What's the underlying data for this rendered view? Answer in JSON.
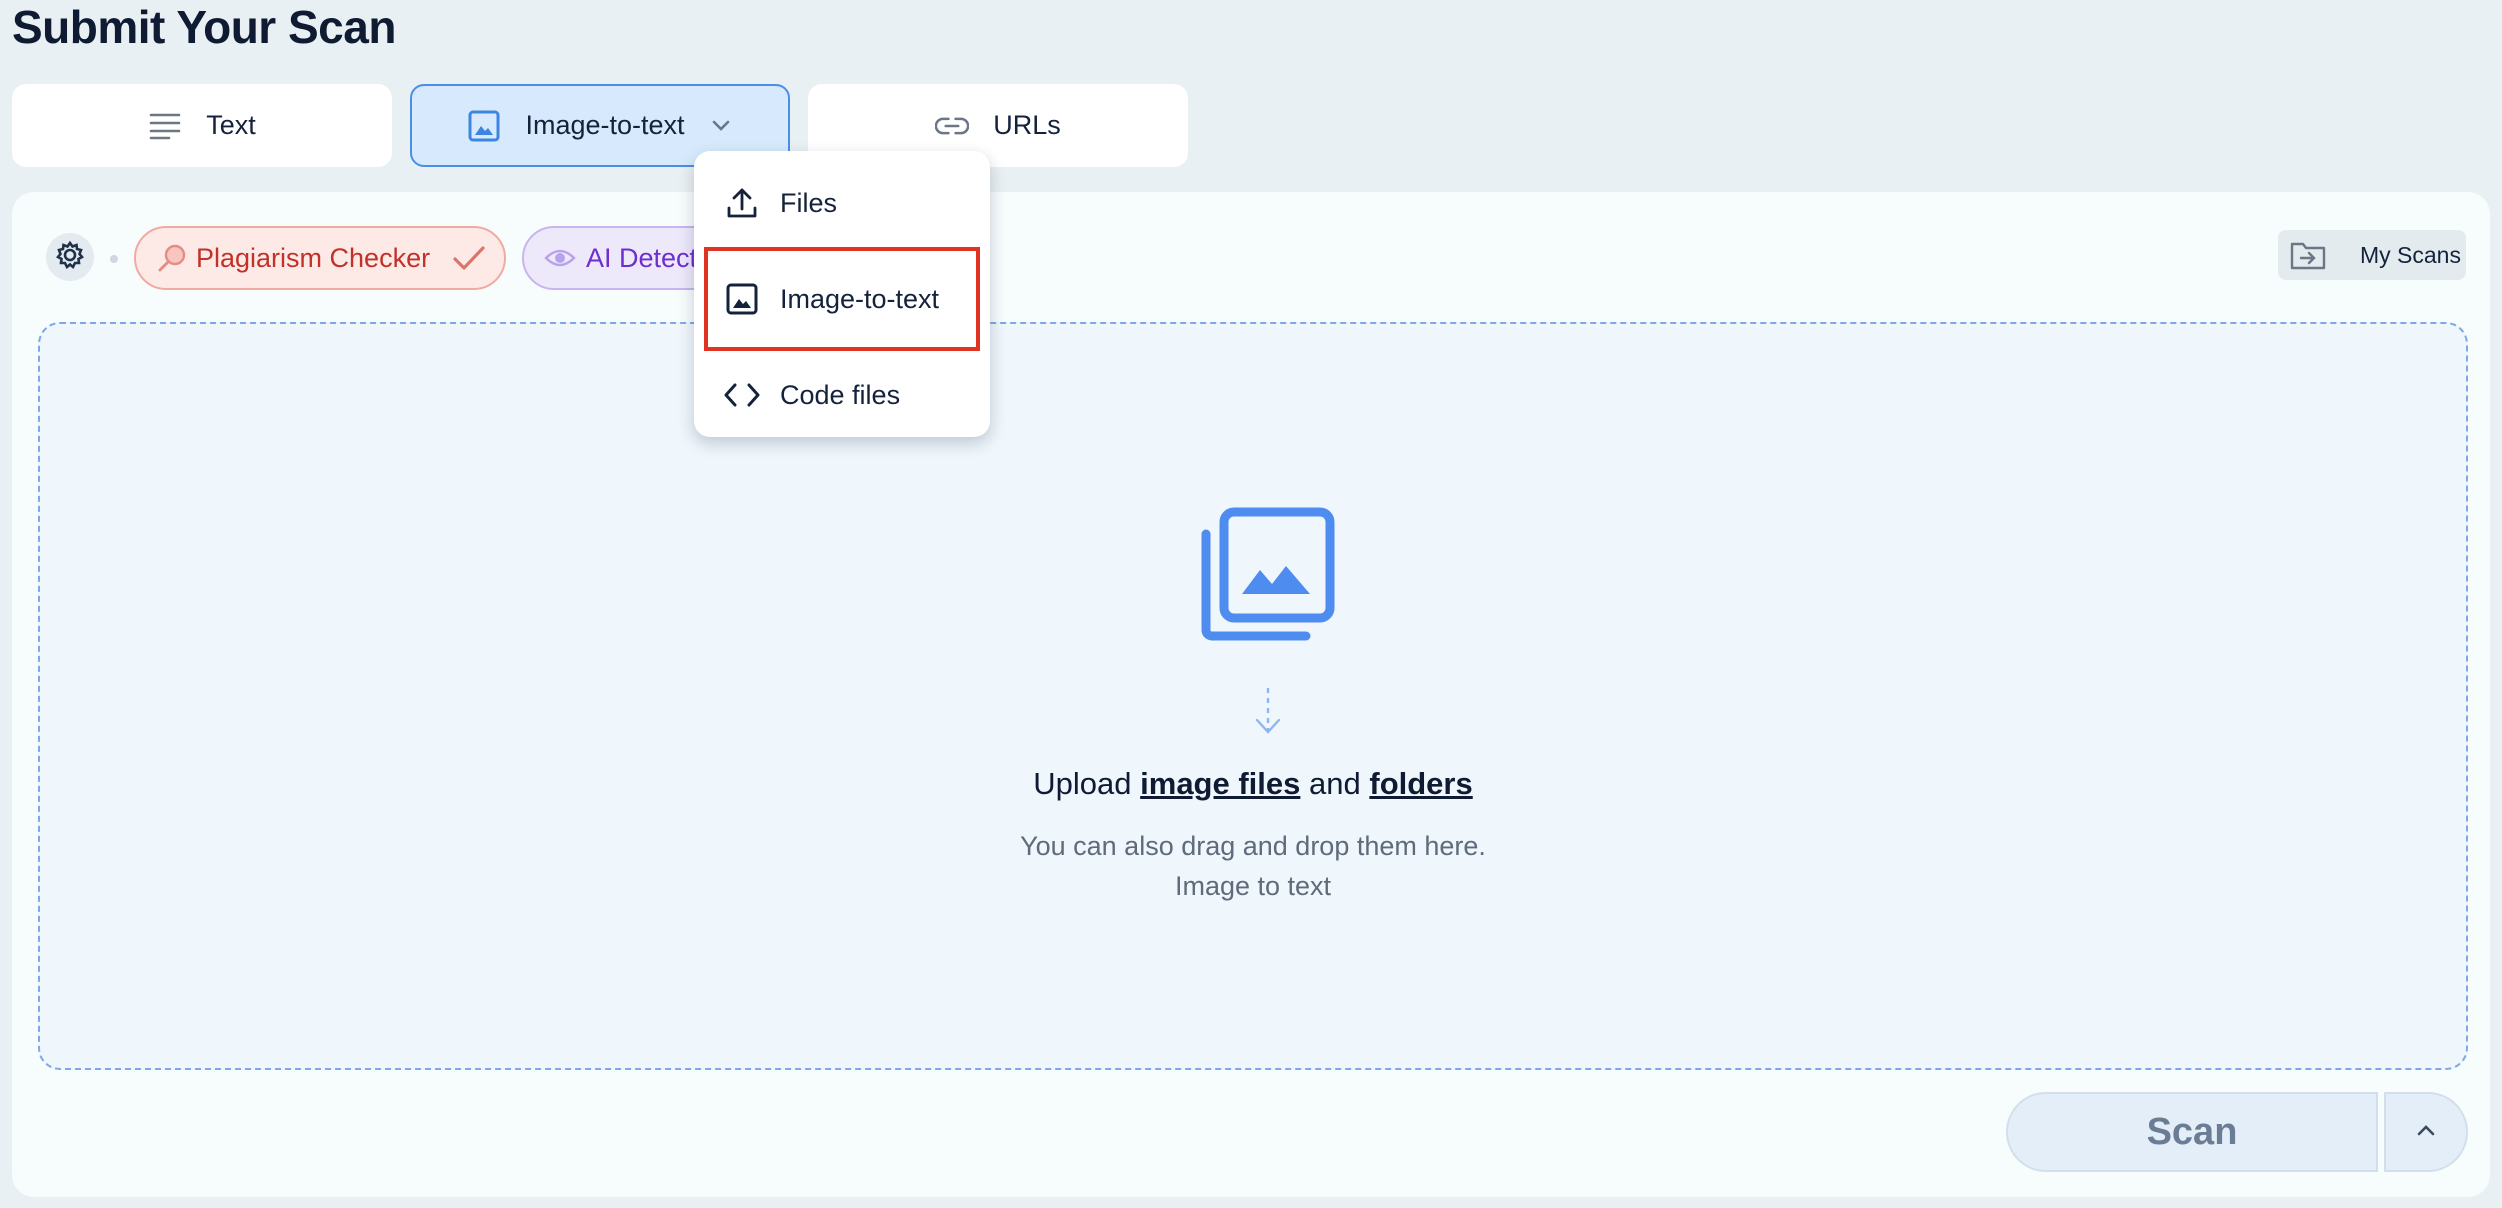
{
  "page": {
    "title": "Submit Your Scan"
  },
  "tabs": [
    {
      "label": "Text",
      "icon": "text-lines-icon"
    },
    {
      "label": "Image-to-text",
      "icon": "image-icon",
      "active": true
    },
    {
      "label": "URLs",
      "icon": "link-icon"
    }
  ],
  "toolbar": {
    "plagiarism_label": "Plagiarism Checker",
    "ai_label": "AI Detector",
    "my_scans_label": "My Scans"
  },
  "dropdown": {
    "items": [
      {
        "label": "Files",
        "icon": "upload-icon"
      },
      {
        "label": "Image-to-text",
        "icon": "image-icon",
        "highlighted": true
      },
      {
        "label": "Code files",
        "icon": "code-icon"
      }
    ]
  },
  "dropzone": {
    "prefix": "Upload",
    "link1": "image files",
    "middle": "and",
    "link2": "folders",
    "sub_line1": "You can also drag and drop them here.",
    "sub_line2": "Image to text"
  },
  "scan": {
    "label": "Scan"
  },
  "colors": {
    "accent_blue": "#4a8fe7",
    "plagiarism_red": "#c0322a",
    "ai_purple": "#6d2fd0",
    "highlight_red": "#e03322"
  }
}
